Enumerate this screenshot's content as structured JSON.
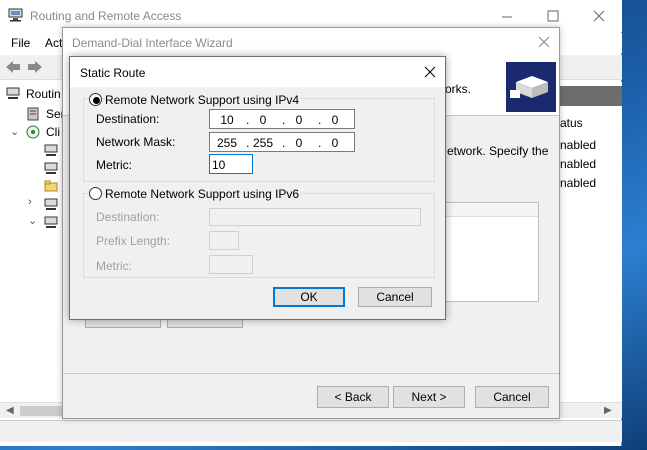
{
  "main_window": {
    "title": "Routing and Remote Access",
    "menu": [
      "File",
      "Acti"
    ],
    "tree": [
      "Routin",
      "Ser",
      "Cli"
    ],
    "right_pane": {
      "header": "atus",
      "rows": [
        "nabled",
        "nabled",
        "nabled"
      ]
    }
  },
  "wizard": {
    "title": "Demand-Dial Interface Wizard",
    "header_text": "orks.",
    "body_text": "etwork. Specify the",
    "buttons": {
      "back": "< Back",
      "next": "Next >",
      "cancel": "Cancel"
    }
  },
  "dialog": {
    "title": "Static Route",
    "ipv4": {
      "radio_label": "Remote Network Support using IPv4",
      "selected": true,
      "destination_label": "Destination:",
      "destination": [
        "10",
        "0",
        "0",
        "0"
      ],
      "mask_label": "Network Mask:",
      "mask": [
        "255",
        "255",
        "0",
        "0"
      ],
      "metric_label": "Metric:",
      "metric": "10"
    },
    "ipv6": {
      "radio_label": "Remote Network Support using IPv6",
      "selected": false,
      "destination_label": "Destination:",
      "prefix_label": "Prefix Length:",
      "metric_label": "Metric:"
    },
    "buttons": {
      "ok": "OK",
      "cancel": "Cancel"
    }
  },
  "colors": {
    "selection": "#0078d7",
    "wizard_logo": "#1b2a6e"
  }
}
